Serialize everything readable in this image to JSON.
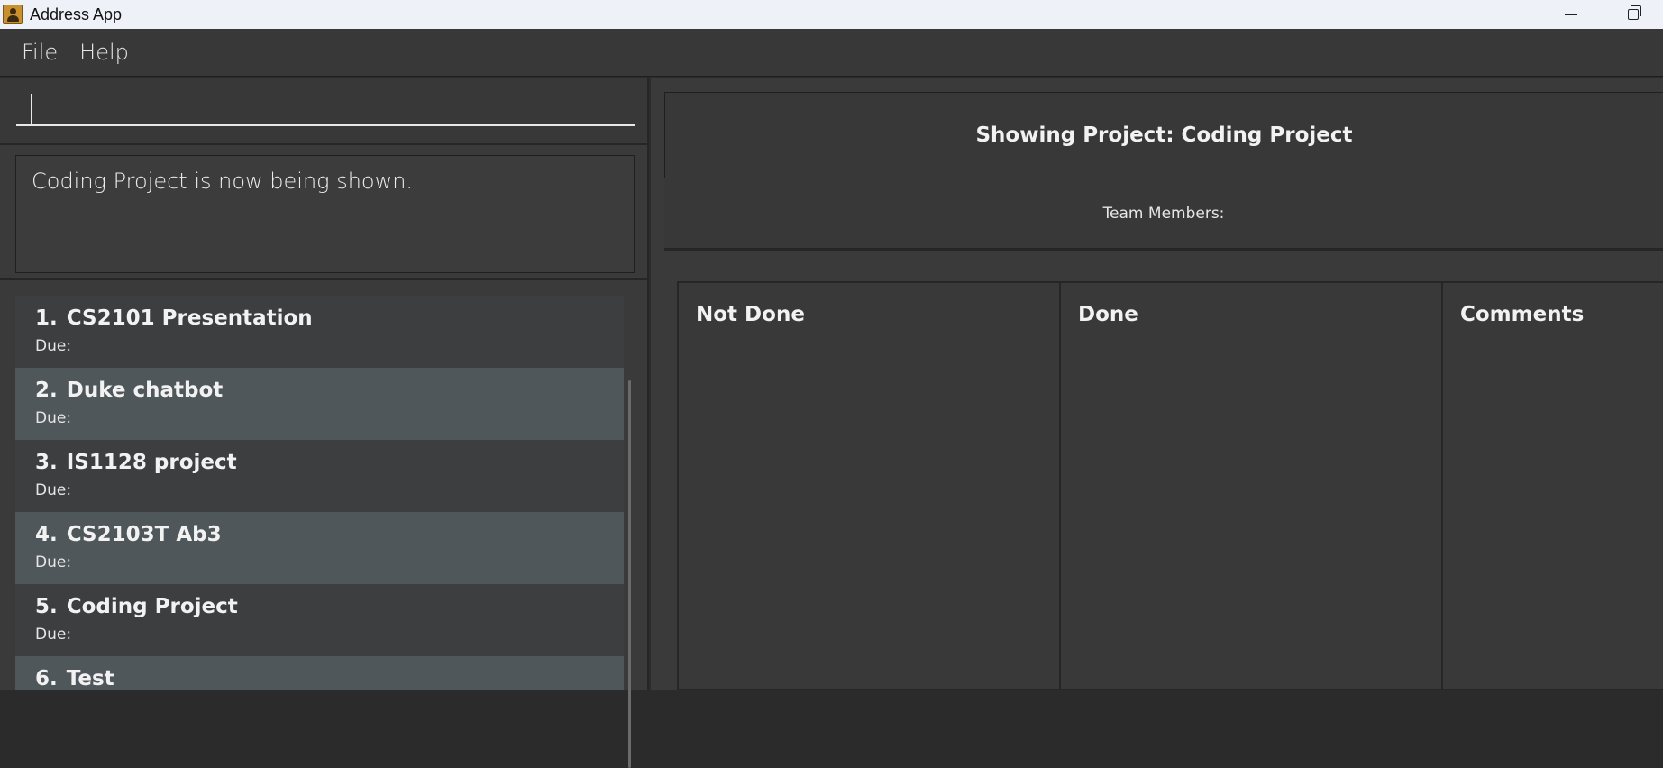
{
  "window": {
    "title": "Address App"
  },
  "menu": {
    "file": "File",
    "help": "Help"
  },
  "command": {
    "value": ""
  },
  "result": {
    "message": "Coding Project is now being shown."
  },
  "projects": [
    {
      "index": "1.",
      "name": "CS2101 Presentation",
      "due": "Due:"
    },
    {
      "index": "2.",
      "name": "Duke chatbot",
      "due": "Due:"
    },
    {
      "index": "3.",
      "name": "IS1128 project",
      "due": "Due:"
    },
    {
      "index": "4.",
      "name": "CS2103T Ab3",
      "due": "Due:"
    },
    {
      "index": "5.",
      "name": "Coding Project",
      "due": "Due:"
    },
    {
      "index": "6.",
      "name": "Test",
      "due": ""
    }
  ],
  "project_view": {
    "title": "Showing Project: Coding Project",
    "team_label": "Team Members:",
    "columns": [
      "Not Done",
      "Done",
      "Comments"
    ]
  }
}
